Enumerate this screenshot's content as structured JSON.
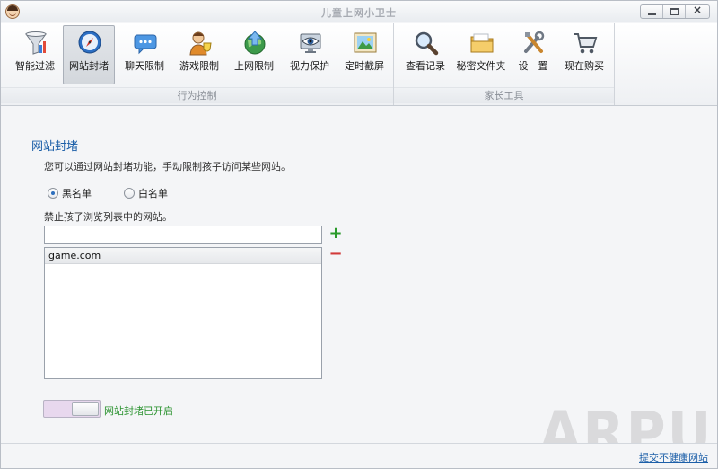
{
  "window": {
    "title": "儿童上网小卫士",
    "close_glyph": "×"
  },
  "ribbon": {
    "groups": [
      {
        "label": "行为控制"
      },
      {
        "label": "家长工具"
      }
    ],
    "tools": [
      {
        "label": "智能过滤",
        "icon": "funnel-icon"
      },
      {
        "label": "网站封堵",
        "icon": "compass-icon",
        "active": true
      },
      {
        "label": "聊天限制",
        "icon": "chat-bubble-icon"
      },
      {
        "label": "游戏限制",
        "icon": "game-character-icon"
      },
      {
        "label": "上网限制",
        "icon": "globe-arrow-icon"
      },
      {
        "label": "视力保护",
        "icon": "eye-monitor-icon"
      },
      {
        "label": "定时截屏",
        "icon": "landscape-picture-icon"
      },
      {
        "label": "查看记录",
        "icon": "magnifier-icon"
      },
      {
        "label": "秘密文件夹",
        "icon": "folder-icon"
      },
      {
        "label": "设　置",
        "icon": "wrench-tools-icon"
      },
      {
        "label": "现在购买",
        "icon": "shopping-cart-icon"
      }
    ]
  },
  "main": {
    "title": "网站封堵",
    "description": "您可以通过网站封堵功能，手动限制孩子访问某些网站。",
    "modes": [
      {
        "label": "黑名单",
        "checked": true
      },
      {
        "label": "白名单",
        "checked": false
      }
    ],
    "list_hint": "禁止孩子浏览列表中的网站。",
    "url_input": {
      "value": "",
      "placeholder": ""
    },
    "add_glyph": "+",
    "remove_glyph": "−",
    "sites": [
      "game.com"
    ],
    "toggle": {
      "on": true,
      "label": "网站封堵已开启"
    }
  },
  "watermark": "ARPUN",
  "status": {
    "report_link": "提交不健康网站"
  }
}
